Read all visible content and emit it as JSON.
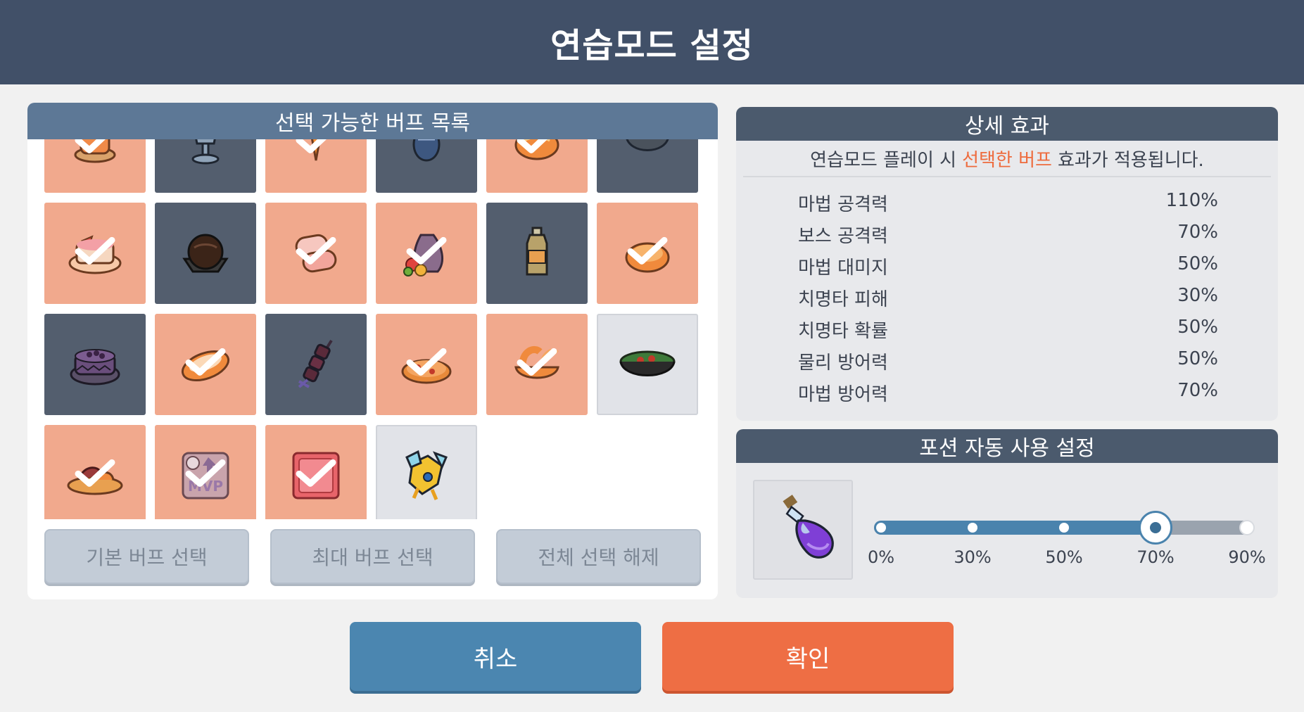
{
  "header": {
    "title": "연습모드 설정"
  },
  "buff_list": {
    "title": "선택 가능한 버프 목록",
    "items": [
      {
        "icon": "pudding-cake-icon",
        "tone": "orange",
        "checked": true
      },
      {
        "icon": "trophy-cup-icon",
        "tone": "dark",
        "checked": false
      },
      {
        "icon": "carrot-icon",
        "tone": "orange",
        "checked": true
      },
      {
        "icon": "ceramic-vase-icon",
        "tone": "dark",
        "checked": false
      },
      {
        "icon": "bread-bun-icon",
        "tone": "orange",
        "checked": true
      },
      {
        "icon": "stone-bowl-icon",
        "tone": "dark",
        "checked": false
      },
      {
        "icon": "fruit-cake-icon",
        "tone": "orange",
        "checked": true
      },
      {
        "icon": "chocolate-truffle-icon",
        "tone": "dark",
        "checked": false
      },
      {
        "icon": "rice-cake-roll-icon",
        "tone": "orange",
        "checked": true
      },
      {
        "icon": "fruit-sack-icon",
        "tone": "orange",
        "checked": true
      },
      {
        "icon": "juice-bottle-icon",
        "tone": "dark",
        "checked": false
      },
      {
        "icon": "bread-loaf-icon",
        "tone": "orange",
        "checked": true
      },
      {
        "icon": "berry-cake-icon",
        "tone": "dark",
        "checked": false
      },
      {
        "icon": "baguette-icon",
        "tone": "orange",
        "checked": true
      },
      {
        "icon": "meat-skewer-icon",
        "tone": "dark",
        "checked": false
      },
      {
        "icon": "pizza-icon",
        "tone": "orange",
        "checked": true
      },
      {
        "icon": "fried-shrimp-bowl-icon",
        "tone": "orange",
        "checked": true
      },
      {
        "icon": "bibimbap-bowl-icon",
        "tone": "light",
        "checked": false
      },
      {
        "icon": "meat-platter-icon",
        "tone": "orange",
        "checked": true
      },
      {
        "icon": "mvp-coupon-icon",
        "tone": "orange",
        "checked": true
      },
      {
        "icon": "event-ticket-icon",
        "tone": "orange",
        "checked": true
      },
      {
        "icon": "golden-dragon-icon",
        "tone": "light",
        "checked": false
      }
    ],
    "buttons": {
      "basic": "기본 버프 선택",
      "max": "최대 버프 선택",
      "clear": "전체 선택 해제"
    }
  },
  "details": {
    "title": "상세 효과",
    "subtitle_before": "연습모드 플레이 시",
    "subtitle_highlight": "선택한 버프",
    "subtitle_after": "효과가 적용됩니다.",
    "highlight_color": "#ee6b3d",
    "effects": [
      {
        "name": "마법 공격력",
        "value": "110%"
      },
      {
        "name": "보스 공격력",
        "value": "70%"
      },
      {
        "name": "마법 대미지",
        "value": "50%"
      },
      {
        "name": "치명타 피해",
        "value": "30%"
      },
      {
        "name": "치명타 확률",
        "value": "50%"
      },
      {
        "name": "물리 방어력",
        "value": "50%"
      },
      {
        "name": "마법 방어력",
        "value": "70%"
      }
    ]
  },
  "potion": {
    "title": "포션 자동 사용 설정",
    "icon": "purple-potion-icon",
    "stops": [
      "0%",
      "30%",
      "50%",
      "70%",
      "90%"
    ],
    "selected_index": 3
  },
  "footer": {
    "cancel": "취소",
    "confirm": "확인"
  },
  "colors": {
    "header_bg": "#415068",
    "selected_cell": "#f1a98d",
    "unselected_cell": "#535e6e",
    "cancel": "#4b86b0",
    "confirm": "#ee6e44"
  }
}
